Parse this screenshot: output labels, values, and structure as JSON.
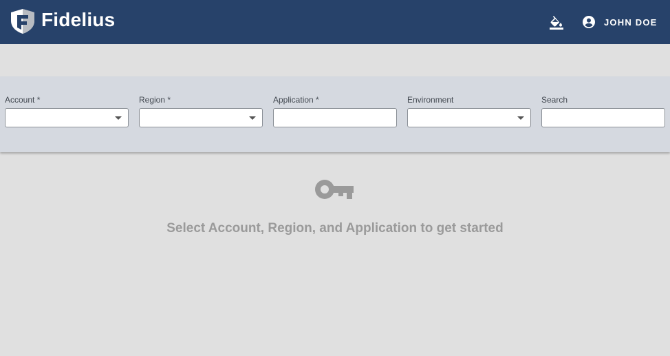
{
  "header": {
    "brand": "Fidelius",
    "logo_icon": "shield-logo-icon",
    "theme_icon": "format-color-fill-icon",
    "user_icon": "account-circle-icon",
    "user_name": "JOHN DOE",
    "background_color": "#27426a"
  },
  "filters": {
    "account": {
      "label": "Account *",
      "value": "",
      "type": "select"
    },
    "region": {
      "label": "Region *",
      "value": "",
      "type": "select"
    },
    "application": {
      "label": "Application *",
      "value": "",
      "type": "text"
    },
    "environment": {
      "label": "Environment",
      "value": "",
      "type": "select"
    },
    "search": {
      "label": "Search",
      "value": "",
      "type": "text"
    }
  },
  "empty_state": {
    "icon": "key-icon",
    "message": "Select Account, Region, and Application to get started"
  }
}
